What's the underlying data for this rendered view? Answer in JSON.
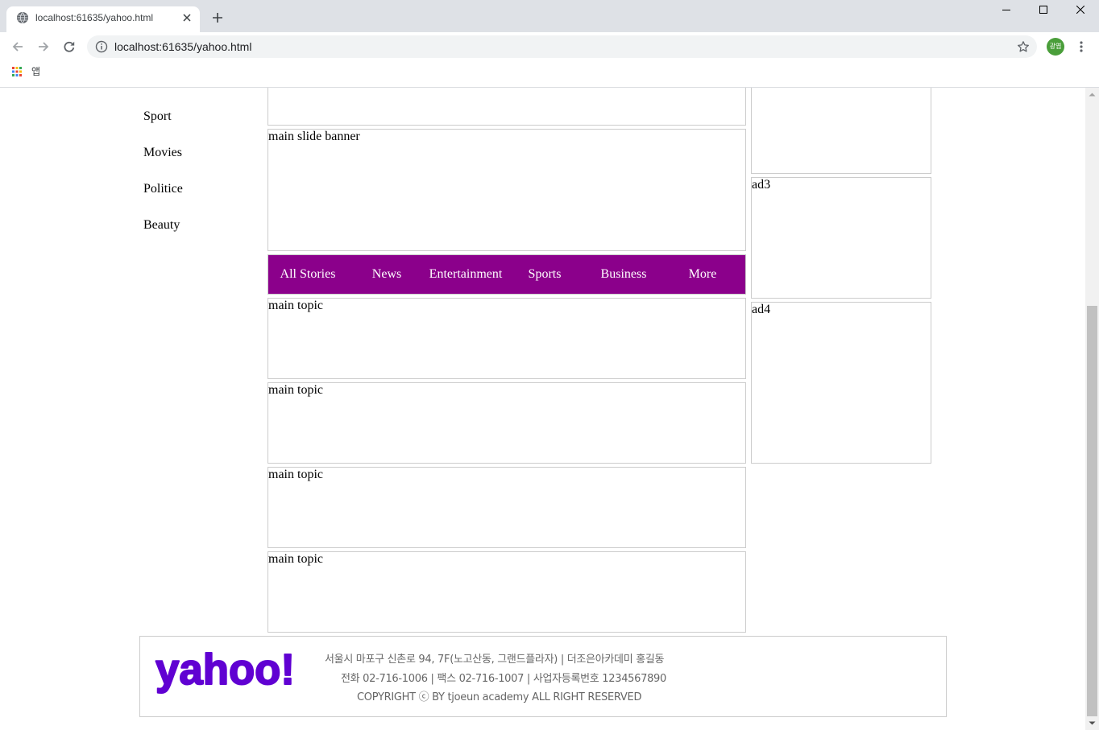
{
  "browser": {
    "tab": {
      "title": "localhost:61635/yahoo.html",
      "favicon_icon": "globe-icon",
      "close_icon": "close-tab-icon"
    },
    "new_tab_icon": "plus-icon",
    "window_controls": [
      "minimize-icon",
      "maximize-icon",
      "close-window-icon"
    ],
    "navigation_icons": [
      "back-arrow-icon",
      "forward-arrow-icon",
      "reload-icon"
    ],
    "address_bar": {
      "url": "localhost:61635/yahoo.html",
      "info_icon": "info-icon",
      "bookmark_icon": "star-icon"
    },
    "profile": {
      "initials": "광엽",
      "color": "#4a9e3a"
    },
    "menu_icon": "kebab-menu-icon",
    "bookmarks_bar": {
      "apps_icon": "apps-grid-icon",
      "apps_label": "앱"
    },
    "scrollbar": {
      "visible_fraction": 0.667,
      "scroll_position": 1.0
    }
  },
  "page": {
    "sidebar": {
      "items": [
        "Sport",
        "Movies",
        "Politice",
        "Beauty"
      ]
    },
    "main": {
      "slide_banner": "main slide banner",
      "nav": {
        "background": "#8b008b",
        "items": [
          "All Stories",
          "News",
          "Entertainment",
          "Sports",
          "Business",
          "More"
        ]
      },
      "topics": [
        "main topic",
        "main topic",
        "main topic",
        "main topic"
      ]
    },
    "aside": {
      "ads": [
        "ad3",
        "ad4"
      ]
    },
    "footer": {
      "logo_text": "yahoo!",
      "logo_color": "#6001d2",
      "address_line": "서울시 마포구 신촌로 94, 7F(노고산동, 그랜드플라자) | 더조은아카데미 홍길동",
      "contact_line": "전화 02-716-1006 | 팩스 02-716-1007 | 사업자등록번호 1234567890",
      "copyright_line": "COPYRIGHT ⓒ BY tjoeun academy ALL RIGHT RESERVED"
    }
  }
}
